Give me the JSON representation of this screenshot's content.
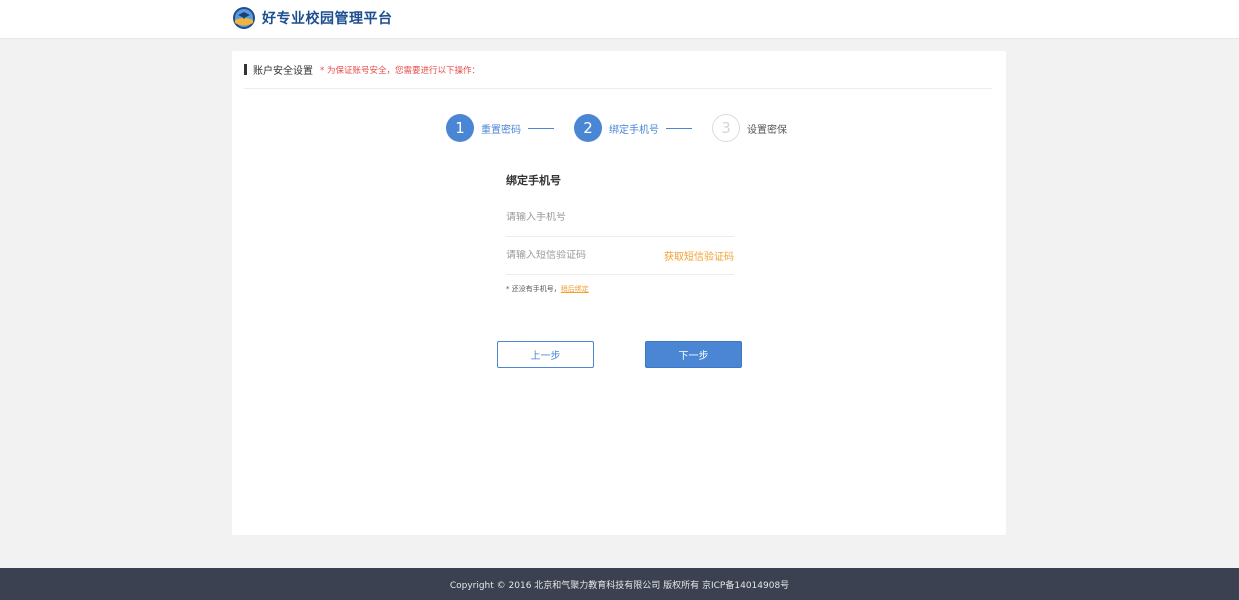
{
  "header": {
    "logo_icon": "graduation-globe-icon",
    "title": "好专业校园管理平台"
  },
  "card": {
    "title": "账户安全设置",
    "note": "* 为保证账号安全，您需要进行以下操作："
  },
  "steps": [
    {
      "number": "1",
      "label": "重置密码",
      "state": "done"
    },
    {
      "number": "2",
      "label": "绑定手机号",
      "state": "active"
    },
    {
      "number": "3",
      "label": "设置密保",
      "state": "inactive"
    }
  ],
  "form": {
    "title": "绑定手机号",
    "phone_placeholder": "请输入手机号",
    "phone_value": "",
    "code_placeholder": "请输入短信验证码",
    "code_value": "",
    "sms_button": "获取短信验证码",
    "hint_prefix": "* 还没有手机号，",
    "hint_link": "稍后绑定"
  },
  "buttons": {
    "prev": "上一步",
    "next": "下一步"
  },
  "footer": {
    "copyright": "Copyright © 2016 北京和气聚力教育科技有限公司 版权所有 京ICP备14014908号"
  },
  "colors": {
    "accent": "#4a86d4",
    "warning": "#e84b4b",
    "link": "#f0a030",
    "footer_bg": "#3b4150"
  }
}
